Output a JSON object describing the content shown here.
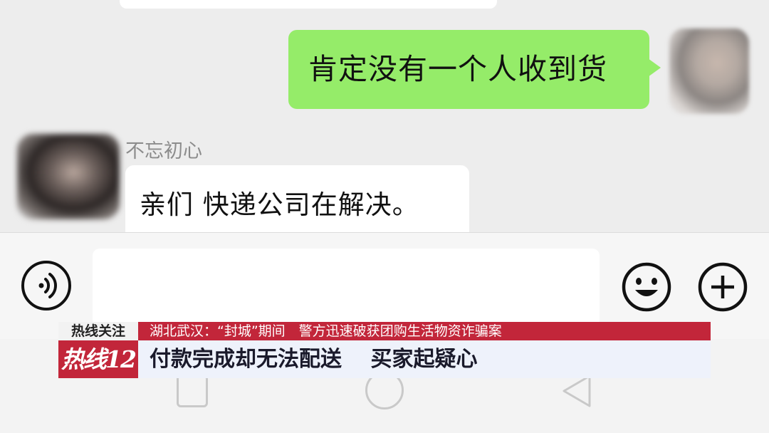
{
  "chat": {
    "messages": [
      {
        "direction": "outgoing",
        "text": "肯定没有一个人收到货"
      },
      {
        "direction": "incoming",
        "sender": "不忘初心",
        "text": "亲们 快递公司在解决。"
      }
    ]
  },
  "input_bar": {
    "text_value": "",
    "icons": {
      "voice": "voice-icon",
      "emoji": "emoji-icon",
      "plus": "plus-icon"
    }
  },
  "nav_bar": {
    "icons": [
      "recent-apps-icon",
      "home-icon",
      "back-icon"
    ]
  },
  "ticker": {
    "tag": "热线关注",
    "headline": "湖北武汉：“封城”期间　警方迅速破获团购生活物资诈骗案",
    "logo_text": "热线12",
    "subtitle": "付款完成却无法配送　 买家起疑心",
    "colors": {
      "accent": "#c2263a",
      "bar": "#eef2fb"
    }
  },
  "colors": {
    "outgoing_bubble": "#95ec69",
    "incoming_bubble": "#ffffff",
    "background": "#ededed"
  }
}
